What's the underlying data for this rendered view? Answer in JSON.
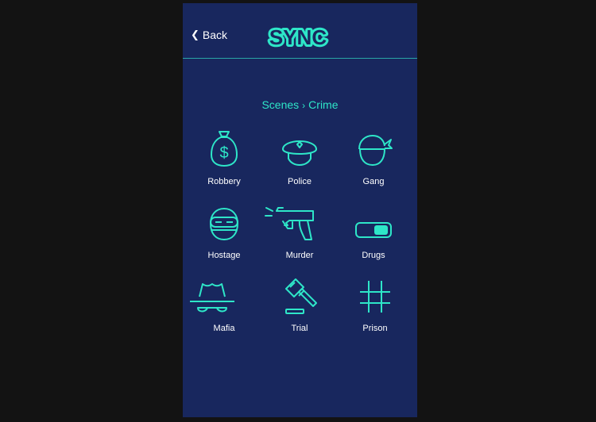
{
  "header": {
    "back_label": "Back",
    "logo_text": "SYNC"
  },
  "breadcrumb": {
    "parent": "Scenes",
    "separator": "›",
    "current": "Crime"
  },
  "scenes": [
    {
      "label": "Robbery",
      "icon": "money-bag-icon"
    },
    {
      "label": "Police",
      "icon": "police-cap-icon"
    },
    {
      "label": "Gang",
      "icon": "bandana-icon"
    },
    {
      "label": "Hostage",
      "icon": "masked-face-icon"
    },
    {
      "label": "Murder",
      "icon": "gun-icon"
    },
    {
      "label": "Drugs",
      "icon": "pill-icon"
    },
    {
      "label": "Mafia",
      "icon": "fedora-icon"
    },
    {
      "label": "Trial",
      "icon": "gavel-icon"
    },
    {
      "label": "Prison",
      "icon": "prison-bars-icon"
    }
  ],
  "colors": {
    "background": "#131313",
    "panel": "#18275e",
    "accent": "#2ee6c8",
    "text": "#ffffff"
  }
}
